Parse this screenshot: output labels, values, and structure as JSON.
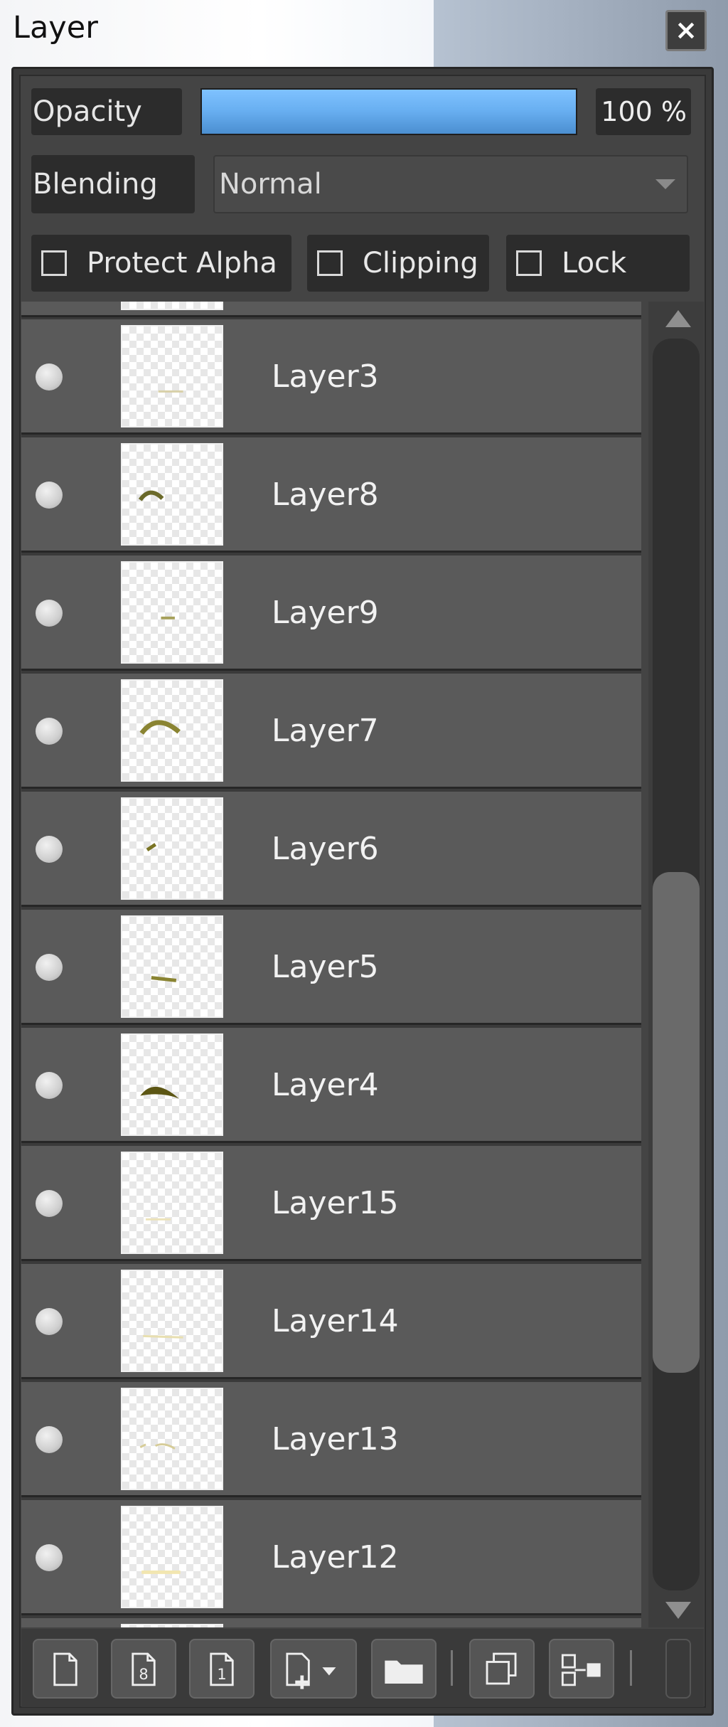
{
  "window": {
    "title": "Layer",
    "close_label": "×"
  },
  "controls": {
    "opacity_label": "Opacity",
    "opacity_value_text": "100 %",
    "opacity_percent": 100,
    "blending_label": "Blending",
    "blending_value": "Normal",
    "checkboxes": [
      {
        "label": "Protect Alpha",
        "checked": false
      },
      {
        "label": "Clipping",
        "checked": false
      },
      {
        "label": "Lock",
        "checked": false
      }
    ]
  },
  "layers": [
    {
      "name": "Layer3",
      "visible": true
    },
    {
      "name": "Layer8",
      "visible": true
    },
    {
      "name": "Layer9",
      "visible": true
    },
    {
      "name": "Layer7",
      "visible": true
    },
    {
      "name": "Layer6",
      "visible": true
    },
    {
      "name": "Layer5",
      "visible": true
    },
    {
      "name": "Layer4",
      "visible": true
    },
    {
      "name": "Layer15",
      "visible": true
    },
    {
      "name": "Layer14",
      "visible": true
    },
    {
      "name": "Layer13",
      "visible": true
    },
    {
      "name": "Layer12",
      "visible": true
    }
  ],
  "toolbar": {
    "buttons": [
      {
        "icon": "new-layer-icon"
      },
      {
        "icon": "new-8bit-layer-icon"
      },
      {
        "icon": "new-1bit-layer-icon"
      },
      {
        "icon": "add-layer-menu-icon"
      },
      {
        "icon": "folder-icon"
      },
      {
        "icon": "duplicate-layer-icon"
      },
      {
        "icon": "merge-down-icon"
      }
    ]
  },
  "colors": {
    "accent": "#67aef0",
    "panel_bg": "#444444",
    "row_bg": "#5a5a5a",
    "stroke_color": "#7a7424"
  }
}
